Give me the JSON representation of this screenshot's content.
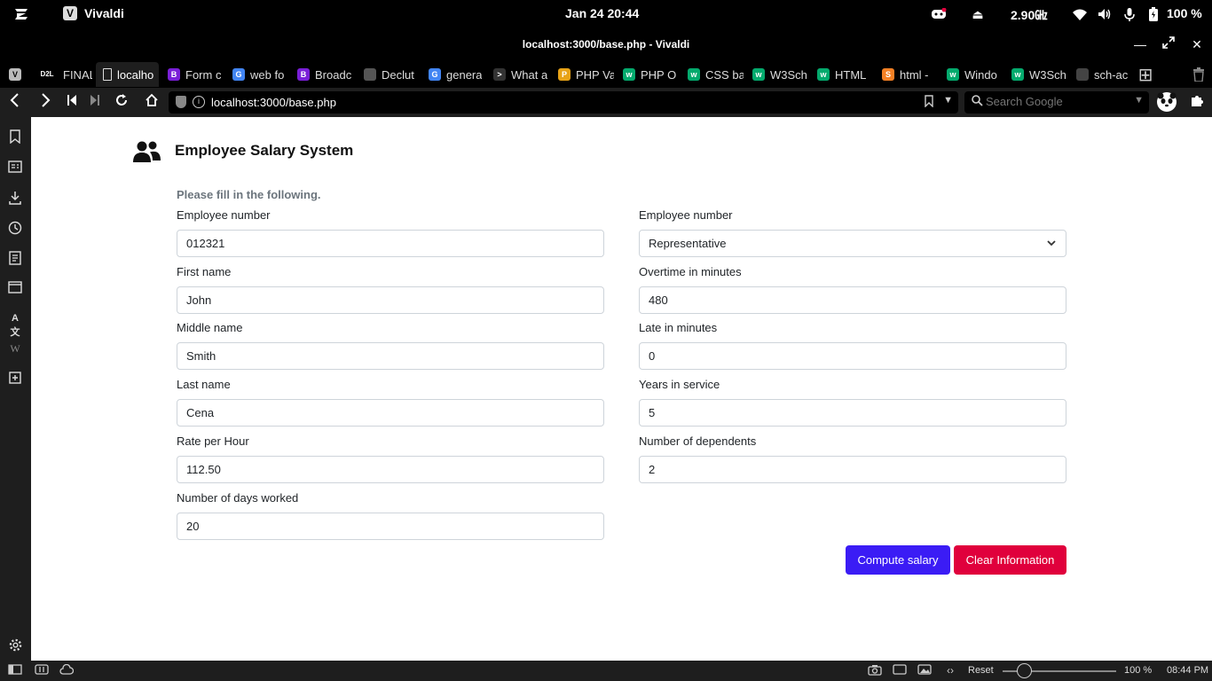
{
  "system": {
    "app_name": "Vivaldi",
    "clock": "Jan 24  20:44",
    "cpu": "2.90㎓",
    "battery": "100 %"
  },
  "window": {
    "title": "localhost:3000/base.php - Vivaldi"
  },
  "tabs": [
    {
      "label": "FINAL",
      "fav": "D2L",
      "color": "#000"
    },
    {
      "label": "localho",
      "fav": "",
      "color": "#555"
    },
    {
      "label": "Form c",
      "fav": "B",
      "color": "#7a1fd8"
    },
    {
      "label": "web fo",
      "fav": "G",
      "color": "#4285f4"
    },
    {
      "label": "Broadc",
      "fav": "B",
      "color": "#7a1fd8"
    },
    {
      "label": "Declut",
      "fav": "",
      "color": "#555"
    },
    {
      "label": "genera",
      "fav": "G",
      "color": "#4285f4"
    },
    {
      "label": "What a",
      "fav": ">",
      "color": "#333"
    },
    {
      "label": "PHP Va",
      "fav": "P",
      "color": "#e8a317"
    },
    {
      "label": "PHP O",
      "fav": "w",
      "color": "#04aa6d"
    },
    {
      "label": "CSS ba",
      "fav": "w",
      "color": "#04aa6d"
    },
    {
      "label": "W3Sch",
      "fav": "w",
      "color": "#04aa6d"
    },
    {
      "label": "HTML",
      "fav": "w",
      "color": "#04aa6d"
    },
    {
      "label": "html -",
      "fav": "S",
      "color": "#f48024"
    },
    {
      "label": "Windo",
      "fav": "w",
      "color": "#04aa6d"
    },
    {
      "label": "W3Sch",
      "fav": "w",
      "color": "#04aa6d"
    },
    {
      "label": "sch-ac",
      "fav": "",
      "color": "#444"
    }
  ],
  "address": {
    "url": "localhost:3000/base.php",
    "search_placeholder": "Search Google"
  },
  "app": {
    "title": "Employee Salary System",
    "hint": "Please fill in the following.",
    "fields_left": [
      {
        "label": "Employee number",
        "value": "012321"
      },
      {
        "label": "First name",
        "value": "John"
      },
      {
        "label": "Middle name",
        "value": "Smith"
      },
      {
        "label": "Last name",
        "value": "Cena"
      },
      {
        "label": "Rate per Hour",
        "value": "112.50"
      },
      {
        "label": "Number of days worked",
        "value": "20"
      }
    ],
    "select_field": {
      "label": "Employee number",
      "value": "Representative"
    },
    "fields_right": [
      {
        "label": "Overtime in minutes",
        "value": "480"
      },
      {
        "label": "Late in minutes",
        "value": "0"
      },
      {
        "label": "Years in service",
        "value": "5"
      },
      {
        "label": "Number of dependents",
        "value": "2"
      }
    ],
    "compute_label": "Compute salary",
    "clear_label": "Clear Information"
  },
  "statusbar": {
    "reset_label": "Reset",
    "zoom": "100 %",
    "time": "08:44 PM"
  }
}
